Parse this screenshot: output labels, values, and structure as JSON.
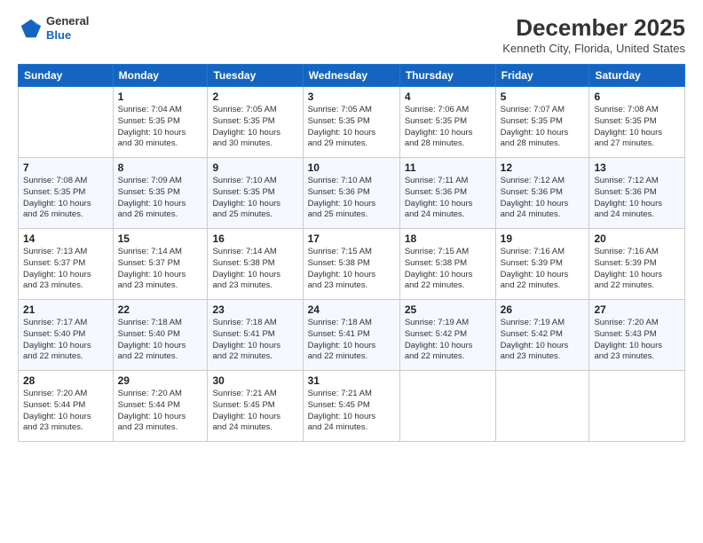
{
  "header": {
    "logo_line1": "General",
    "logo_line2": "Blue",
    "title": "December 2025",
    "subtitle": "Kenneth City, Florida, United States"
  },
  "calendar": {
    "days_of_week": [
      "Sunday",
      "Monday",
      "Tuesday",
      "Wednesday",
      "Thursday",
      "Friday",
      "Saturday"
    ],
    "weeks": [
      [
        {
          "day": "",
          "info": ""
        },
        {
          "day": "1",
          "info": "Sunrise: 7:04 AM\nSunset: 5:35 PM\nDaylight: 10 hours\nand 30 minutes."
        },
        {
          "day": "2",
          "info": "Sunrise: 7:05 AM\nSunset: 5:35 PM\nDaylight: 10 hours\nand 30 minutes."
        },
        {
          "day": "3",
          "info": "Sunrise: 7:05 AM\nSunset: 5:35 PM\nDaylight: 10 hours\nand 29 minutes."
        },
        {
          "day": "4",
          "info": "Sunrise: 7:06 AM\nSunset: 5:35 PM\nDaylight: 10 hours\nand 28 minutes."
        },
        {
          "day": "5",
          "info": "Sunrise: 7:07 AM\nSunset: 5:35 PM\nDaylight: 10 hours\nand 28 minutes."
        },
        {
          "day": "6",
          "info": "Sunrise: 7:08 AM\nSunset: 5:35 PM\nDaylight: 10 hours\nand 27 minutes."
        }
      ],
      [
        {
          "day": "7",
          "info": "Sunrise: 7:08 AM\nSunset: 5:35 PM\nDaylight: 10 hours\nand 26 minutes."
        },
        {
          "day": "8",
          "info": "Sunrise: 7:09 AM\nSunset: 5:35 PM\nDaylight: 10 hours\nand 26 minutes."
        },
        {
          "day": "9",
          "info": "Sunrise: 7:10 AM\nSunset: 5:35 PM\nDaylight: 10 hours\nand 25 minutes."
        },
        {
          "day": "10",
          "info": "Sunrise: 7:10 AM\nSunset: 5:36 PM\nDaylight: 10 hours\nand 25 minutes."
        },
        {
          "day": "11",
          "info": "Sunrise: 7:11 AM\nSunset: 5:36 PM\nDaylight: 10 hours\nand 24 minutes."
        },
        {
          "day": "12",
          "info": "Sunrise: 7:12 AM\nSunset: 5:36 PM\nDaylight: 10 hours\nand 24 minutes."
        },
        {
          "day": "13",
          "info": "Sunrise: 7:12 AM\nSunset: 5:36 PM\nDaylight: 10 hours\nand 24 minutes."
        }
      ],
      [
        {
          "day": "14",
          "info": "Sunrise: 7:13 AM\nSunset: 5:37 PM\nDaylight: 10 hours\nand 23 minutes."
        },
        {
          "day": "15",
          "info": "Sunrise: 7:14 AM\nSunset: 5:37 PM\nDaylight: 10 hours\nand 23 minutes."
        },
        {
          "day": "16",
          "info": "Sunrise: 7:14 AM\nSunset: 5:38 PM\nDaylight: 10 hours\nand 23 minutes."
        },
        {
          "day": "17",
          "info": "Sunrise: 7:15 AM\nSunset: 5:38 PM\nDaylight: 10 hours\nand 23 minutes."
        },
        {
          "day": "18",
          "info": "Sunrise: 7:15 AM\nSunset: 5:38 PM\nDaylight: 10 hours\nand 22 minutes."
        },
        {
          "day": "19",
          "info": "Sunrise: 7:16 AM\nSunset: 5:39 PM\nDaylight: 10 hours\nand 22 minutes."
        },
        {
          "day": "20",
          "info": "Sunrise: 7:16 AM\nSunset: 5:39 PM\nDaylight: 10 hours\nand 22 minutes."
        }
      ],
      [
        {
          "day": "21",
          "info": "Sunrise: 7:17 AM\nSunset: 5:40 PM\nDaylight: 10 hours\nand 22 minutes."
        },
        {
          "day": "22",
          "info": "Sunrise: 7:18 AM\nSunset: 5:40 PM\nDaylight: 10 hours\nand 22 minutes."
        },
        {
          "day": "23",
          "info": "Sunrise: 7:18 AM\nSunset: 5:41 PM\nDaylight: 10 hours\nand 22 minutes."
        },
        {
          "day": "24",
          "info": "Sunrise: 7:18 AM\nSunset: 5:41 PM\nDaylight: 10 hours\nand 22 minutes."
        },
        {
          "day": "25",
          "info": "Sunrise: 7:19 AM\nSunset: 5:42 PM\nDaylight: 10 hours\nand 22 minutes."
        },
        {
          "day": "26",
          "info": "Sunrise: 7:19 AM\nSunset: 5:42 PM\nDaylight: 10 hours\nand 23 minutes."
        },
        {
          "day": "27",
          "info": "Sunrise: 7:20 AM\nSunset: 5:43 PM\nDaylight: 10 hours\nand 23 minutes."
        }
      ],
      [
        {
          "day": "28",
          "info": "Sunrise: 7:20 AM\nSunset: 5:44 PM\nDaylight: 10 hours\nand 23 minutes."
        },
        {
          "day": "29",
          "info": "Sunrise: 7:20 AM\nSunset: 5:44 PM\nDaylight: 10 hours\nand 23 minutes."
        },
        {
          "day": "30",
          "info": "Sunrise: 7:21 AM\nSunset: 5:45 PM\nDaylight: 10 hours\nand 24 minutes."
        },
        {
          "day": "31",
          "info": "Sunrise: 7:21 AM\nSunset: 5:45 PM\nDaylight: 10 hours\nand 24 minutes."
        },
        {
          "day": "",
          "info": ""
        },
        {
          "day": "",
          "info": ""
        },
        {
          "day": "",
          "info": ""
        }
      ]
    ]
  }
}
